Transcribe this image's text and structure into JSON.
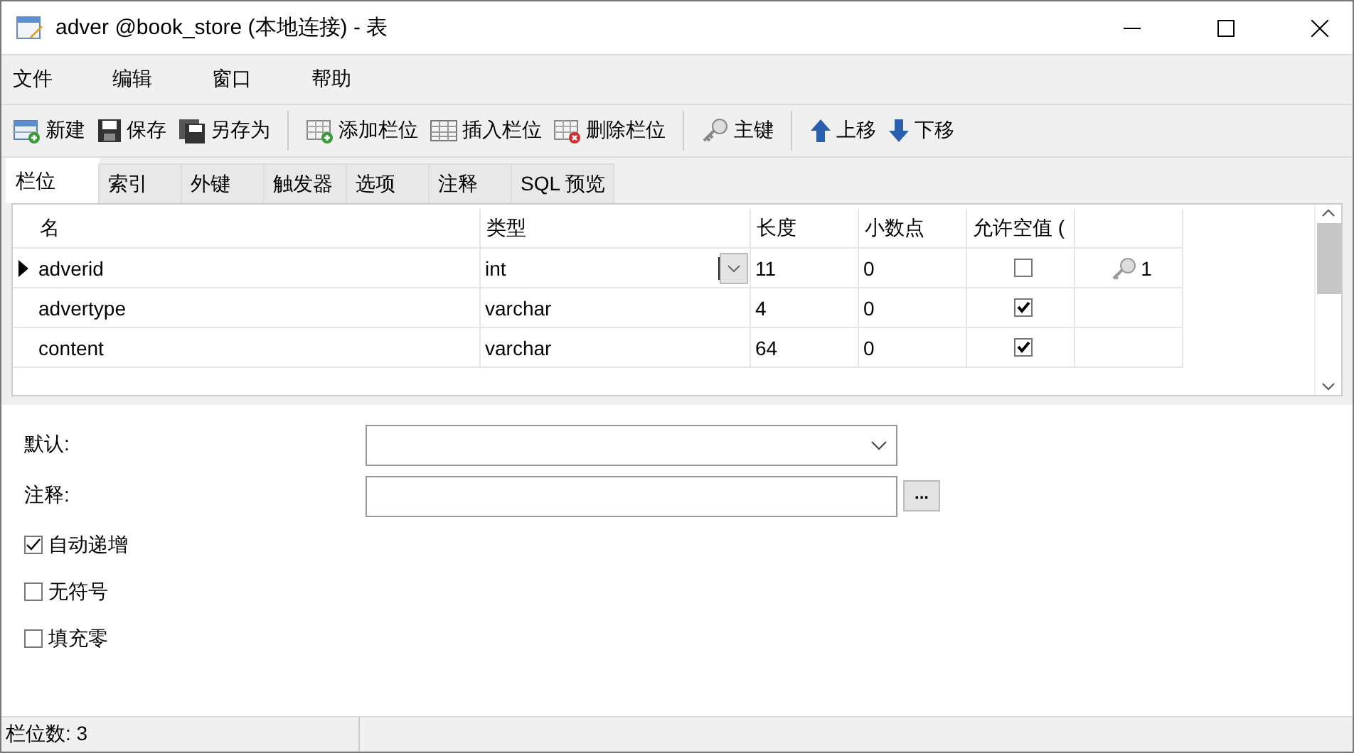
{
  "window": {
    "title": "adver @book_store (本地连接) - 表"
  },
  "menu": [
    "文件",
    "编辑",
    "窗口",
    "帮助"
  ],
  "toolbar": [
    {
      "kind": "button",
      "label": "新建"
    },
    {
      "kind": "button",
      "label": "保存"
    },
    {
      "kind": "button",
      "label": "另存为"
    },
    {
      "kind": "separator"
    },
    {
      "kind": "button",
      "label": "添加栏位"
    },
    {
      "kind": "button",
      "label": "插入栏位"
    },
    {
      "kind": "button",
      "label": "删除栏位"
    },
    {
      "kind": "separator"
    },
    {
      "kind": "button",
      "label": "主键"
    },
    {
      "kind": "separator"
    },
    {
      "kind": "button",
      "label": "上移"
    },
    {
      "kind": "button",
      "label": "下移"
    }
  ],
  "tabs": [
    {
      "label": "栏位",
      "selected": true
    },
    {
      "label": "索引",
      "selected": false
    },
    {
      "label": "外键",
      "selected": false
    },
    {
      "label": "触发器",
      "selected": false
    },
    {
      "label": "选项",
      "selected": false
    },
    {
      "label": "注释",
      "selected": false
    },
    {
      "label": "SQL 预览",
      "selected": false
    }
  ],
  "table": {
    "columns": [
      "名",
      "类型",
      "长度",
      "小数点",
      "允许空值 ("
    ],
    "rows": [
      {
        "name": "adverid",
        "type": "int",
        "length": "11",
        "decimals": "0",
        "nullable": false,
        "key": "1",
        "selected": true
      },
      {
        "name": "advertype",
        "type": "varchar",
        "length": "4",
        "decimals": "0",
        "nullable": true,
        "selected": false
      },
      {
        "name": "content",
        "type": "varchar",
        "length": "64",
        "decimals": "0",
        "nullable": true,
        "selected": false
      }
    ]
  },
  "properties": {
    "default_label": "默认:",
    "comment_label": "注释:",
    "comment_button": "...",
    "options": [
      {
        "label": "自动递增",
        "checked": true
      },
      {
        "label": "无符号",
        "checked": false
      },
      {
        "label": "填充零",
        "checked": false
      }
    ]
  },
  "status_bar": "栏位数: 3"
}
